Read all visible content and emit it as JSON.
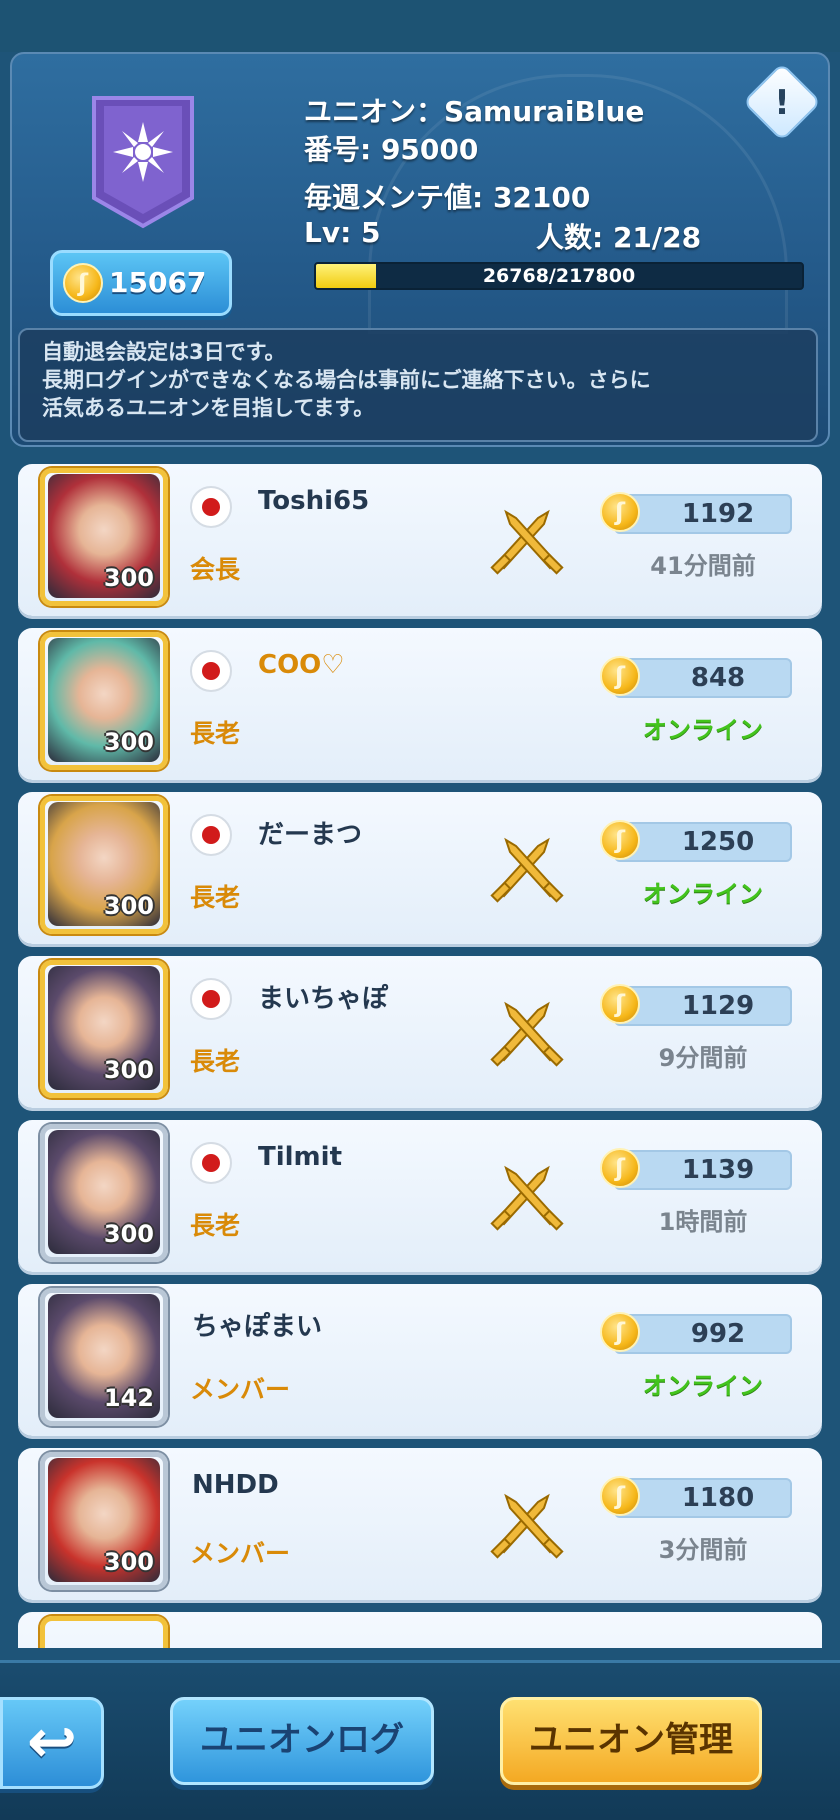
{
  "header": {
    "union_label": "ユニオン：SamuraiBlue",
    "number_label": "番号: 95000",
    "maintenance_label": "毎週メンテ値: 32100",
    "level_label": "Lv: 5",
    "members_label": "人数: 21/28",
    "coins": "15067",
    "xp_text": "26768/217800",
    "xp_progress": 0.123,
    "info_icon": "exclamation-icon"
  },
  "notice": {
    "line1": "自動退会設定は3日です。",
    "line2": "長期ログインができなくなる場合は事前にご連絡下さい。さらに",
    "line3": "活気あるユニオンを目指してます。"
  },
  "members": [
    {
      "name": "Toshi65",
      "role": "会長",
      "level": "300",
      "points": "1192",
      "status": "41分間前",
      "online": false,
      "flag": "japan-flag",
      "swords": true,
      "avatar_color": "#b0303a"
    },
    {
      "name": "COO♡",
      "role": "長老",
      "level": "300",
      "points": "848",
      "status": "オンライン",
      "online": true,
      "flag": "japan-flag",
      "swords": false,
      "avatar_color": "#5fb9a8"
    },
    {
      "name": "だーまつ",
      "role": "長老",
      "level": "300",
      "points": "1250",
      "status": "オンライン",
      "online": true,
      "flag": "japan-flag",
      "swords": true,
      "avatar_color": "#d8a44a"
    },
    {
      "name": "まいちゃぽ",
      "role": "長老",
      "level": "300",
      "points": "1129",
      "status": "9分間前",
      "online": false,
      "flag": "japan-flag",
      "swords": true,
      "avatar_color": "#5b4a6b"
    },
    {
      "name": "Tilmit",
      "role": "長老",
      "level": "300",
      "points": "1139",
      "status": "1時間前",
      "online": false,
      "flag": "japan-flag",
      "swords": true,
      "avatar_color": "#5b4a6b"
    },
    {
      "name": "ちゃぽまい",
      "role": "メンバー",
      "level": "142",
      "points": "992",
      "status": "オンライン",
      "online": true,
      "flag": "",
      "swords": false,
      "avatar_color": "#5b4a6b"
    },
    {
      "name": "NHDD",
      "role": "メンバー",
      "level": "300",
      "points": "1180",
      "status": "3分間前",
      "online": false,
      "flag": "",
      "swords": true,
      "avatar_color": "#c9332c"
    }
  ],
  "footer": {
    "back_icon": "back-arrow-icon",
    "log_label": "ユニオンログ",
    "manage_label": "ユニオン管理"
  },
  "colors": {
    "accent_blue": "#2f95dc",
    "accent_gold": "#f4a923",
    "online_green": "#43c41d",
    "role_orange": "#d98a08"
  }
}
